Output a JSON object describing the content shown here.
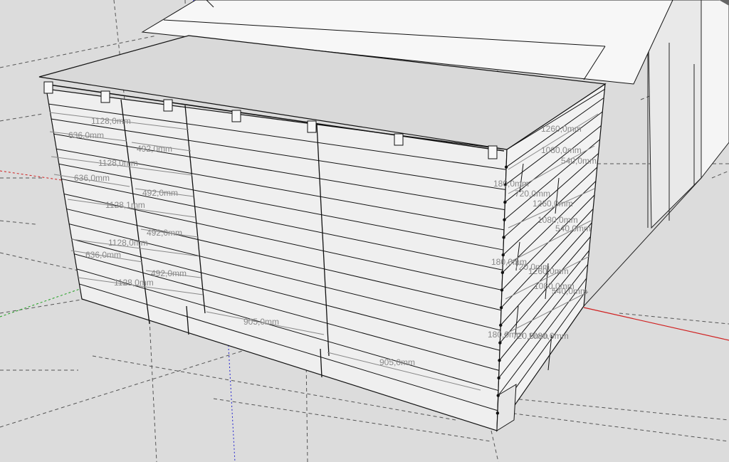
{
  "viewport": {
    "background": "#dcdcdc",
    "axis_colors": {
      "red": "#d02020",
      "green": "#20a020",
      "blue": "#2020d0"
    }
  },
  "dimensions": {
    "front_left": [
      "1128,0mm",
      "636,0mm",
      "492,0mm",
      "1128,0mm",
      "636,0mm",
      "492,0mm",
      "1128,1mm",
      "492,0mm",
      "1128,0mm",
      "636,0mm",
      "492,0mm",
      "1128,0mm"
    ],
    "front_lower": [
      "905,0mm",
      "905,0mm"
    ],
    "side": [
      "1260,0mm",
      "1080,0mm",
      "540,0mm",
      "180,0mm",
      "720,0mm",
      "1260,0mm",
      "1080,0mm",
      "540,0mm",
      "180,0mm",
      "720,0mm",
      "1260,0mm",
      "1080,0mm",
      "540,0mm",
      "180,0mm",
      "720,0mm",
      "1080,0mm"
    ]
  }
}
